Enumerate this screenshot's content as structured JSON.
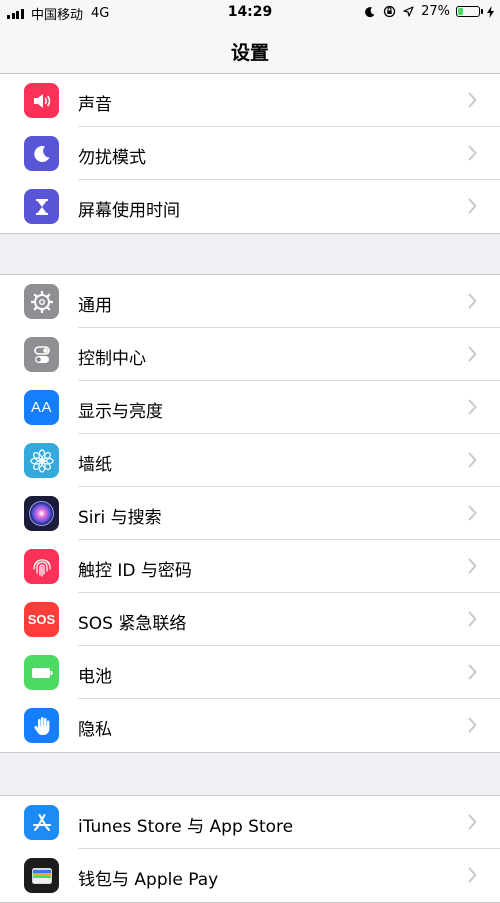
{
  "status_bar": {
    "carrier": "中国移动",
    "network": "4G",
    "time": "14:29",
    "battery_percent": "27%",
    "battery_level": 0.27,
    "icons": [
      "moon-icon",
      "rotation-lock-icon",
      "location-arrow-icon",
      "charging-bolt-icon"
    ]
  },
  "nav": {
    "title": "设置"
  },
  "colors": {
    "sounds": "#fc3158",
    "dnd": "#5856d6",
    "screen_time": "#5856d6",
    "general": "#8e8e93",
    "control_center": "#8e8e93",
    "display": "#147efb",
    "wallpaper": "#34aadc",
    "siri": "#1b1b3a",
    "touch_id": "#fc3158",
    "sos": "#fc3d39",
    "battery": "#4cd964",
    "privacy": "#147efb",
    "app_store": "#1d8bf5",
    "wallet": "#1c1c1e"
  },
  "groups": [
    {
      "items": [
        {
          "label": "声音",
          "icon": "speaker-icon"
        },
        {
          "label": "勿扰模式",
          "icon": "moon-icon"
        },
        {
          "label": "屏幕使用时间",
          "icon": "hourglass-icon"
        }
      ]
    },
    {
      "items": [
        {
          "label": "通用",
          "icon": "gear-icon"
        },
        {
          "label": "控制中心",
          "icon": "toggles-icon"
        },
        {
          "label": "显示与亮度",
          "icon": "text-size-icon",
          "icon_text": "AA"
        },
        {
          "label": "墙纸",
          "icon": "flower-icon"
        },
        {
          "label": "Siri 与搜索",
          "icon": "siri-icon"
        },
        {
          "label": "触控 ID 与密码",
          "icon": "fingerprint-icon"
        },
        {
          "label": "SOS 紧急联络",
          "icon": "sos-icon",
          "icon_text": "SOS"
        },
        {
          "label": "电池",
          "icon": "battery-icon"
        },
        {
          "label": "隐私",
          "icon": "hand-icon"
        }
      ]
    },
    {
      "items": [
        {
          "label": "iTunes Store 与 App Store",
          "icon": "app-store-icon"
        },
        {
          "label": "钱包与 Apple Pay",
          "icon": "wallet-icon"
        }
      ]
    }
  ]
}
